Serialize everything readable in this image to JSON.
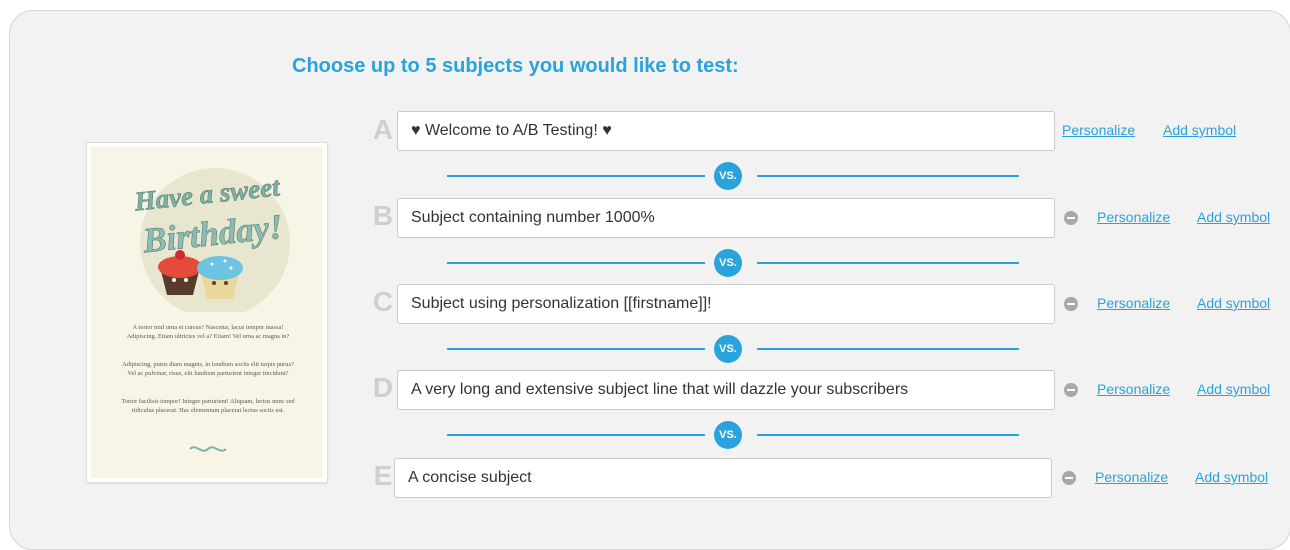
{
  "heading": "Choose up to 5 subjects you would like to test:",
  "preview": {
    "logo_line1": "Have a sweet",
    "logo_line2": "Birthday!",
    "paragraphs": [
      "A tortor mid urna et cursus? Nascetur, lacus tempor massa! Adipiscing. Etiam ultricies vel a? Etiam! Vel urna ac magna in?",
      "Adipiscing, purus diam magnis, in lundium sociis elit turpis purus? Vel ac pulvinar, risus, elit lundium parturient integer tincidunt?",
      "Tortor facilisis tempor! Integer parturient! Aliquam, lectus nunc sed ridiculus placerat. Hac elementum placerat lectus sociis est."
    ]
  },
  "vs_label": "VS.",
  "personalize_label": "Personalize",
  "add_symbol_label": "Add symbol",
  "subjects": [
    {
      "letter": "A",
      "value": "♥ Welcome to A/B Testing! ♥"
    },
    {
      "letter": "B",
      "value": "Subject containing number 1000%"
    },
    {
      "letter": "C",
      "value": "Subject using personalization [[firstname]]!"
    },
    {
      "letter": "D",
      "value": "A very long and extensive subject line that will dazzle your subscribers"
    },
    {
      "letter": "E",
      "value": "A concise subject"
    }
  ],
  "colors": {
    "accent": "#2aa3dc",
    "letter": "#cfcfcf",
    "panel": "#f2f2f2",
    "preview_card": "#f7f6e6",
    "remove_icon": "#a8a8a8"
  }
}
